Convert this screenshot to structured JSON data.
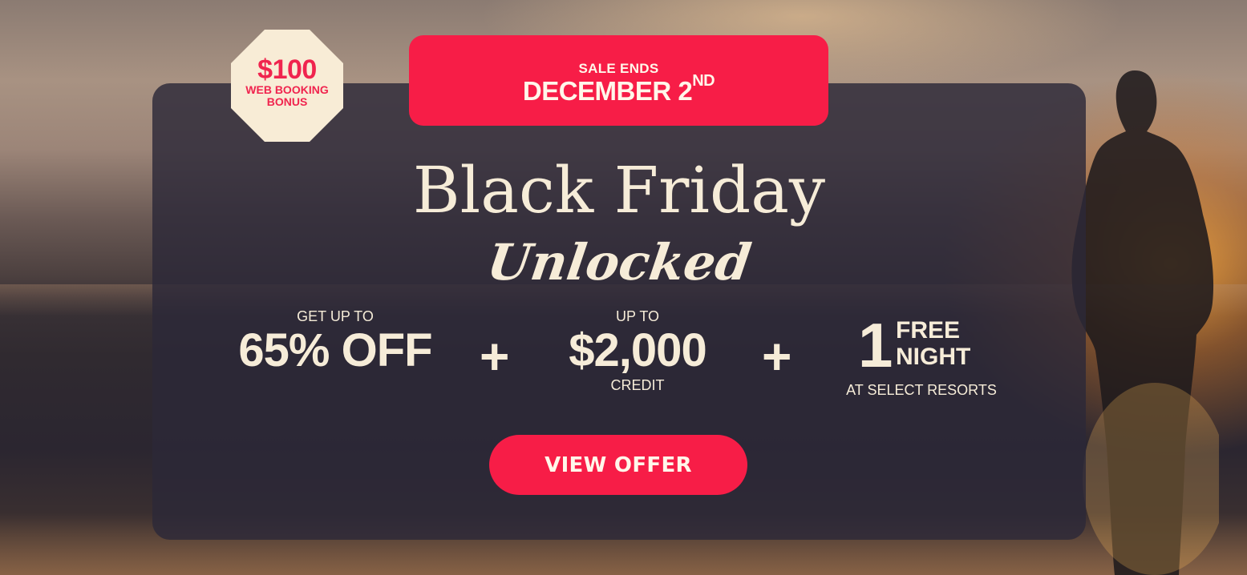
{
  "badge": {
    "amount": "$100",
    "line1": "WEB BOOKING",
    "line2": "BONUS"
  },
  "sale": {
    "line1": "SALE ENDS",
    "date": "DECEMBER 2",
    "suffix": "ND"
  },
  "headline": {
    "title": "Black Friday",
    "subtitle": "Unlocked"
  },
  "offers": {
    "discount": {
      "prefix": "GET UP TO",
      "value": "65% OFF"
    },
    "plus_symbol": "+",
    "credit": {
      "prefix": "UP TO",
      "value": "$2,000",
      "suffix": "CREDIT"
    },
    "free_night": {
      "number": "1",
      "line1": "FREE",
      "line2": "NIGHT",
      "suffix": "AT SELECT RESORTS"
    }
  },
  "cta": {
    "label": "VIEW OFFER"
  },
  "colors": {
    "accent": "#f71d47",
    "cream": "#f6ecd8",
    "panel": "#2c2838"
  }
}
